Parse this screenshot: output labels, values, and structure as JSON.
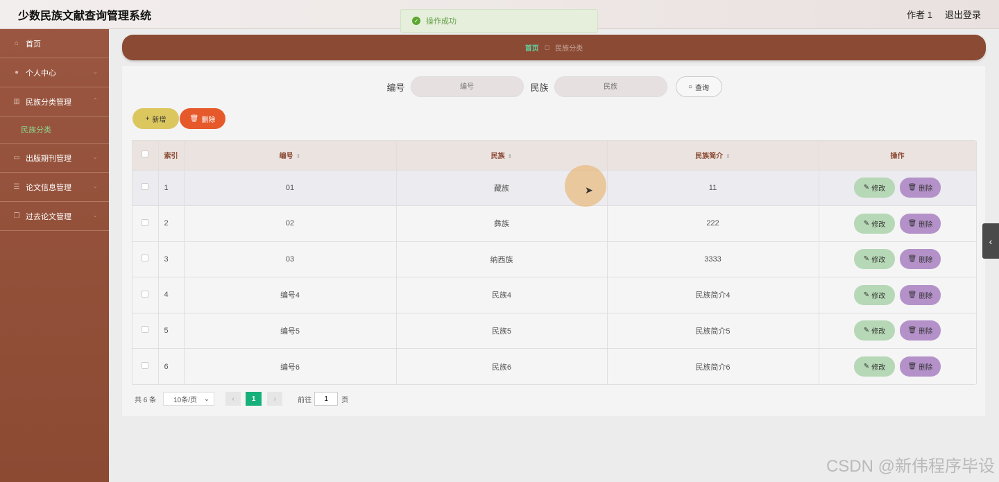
{
  "header": {
    "title": "少数民族文献查询管理系统",
    "user": "作者 1",
    "logout": "退出登录"
  },
  "toast": {
    "message": "操作成功"
  },
  "sidebar": {
    "items": [
      {
        "label": "首页"
      },
      {
        "label": "个人中心"
      },
      {
        "label": "民族分类管理",
        "sub": "民族分类"
      },
      {
        "label": "出版期刊管理"
      },
      {
        "label": "论文信息管理"
      },
      {
        "label": "过去论文管理"
      }
    ]
  },
  "breadcrumb": {
    "home": "首页",
    "current": "民族分类"
  },
  "search": {
    "code_label": "编号",
    "code_placeholder": "编号",
    "ethnic_label": "民族",
    "ethnic_placeholder": "民族",
    "query_label": "查询"
  },
  "actions": {
    "add_label": "新增",
    "delete_label": "删除"
  },
  "table": {
    "headers": {
      "index": "索引",
      "code": "编号",
      "ethnic": "民族",
      "intro": "民族简介",
      "ops": "操作"
    },
    "rows": [
      {
        "index": "1",
        "code": "01",
        "ethnic": "藏族",
        "intro": "11"
      },
      {
        "index": "2",
        "code": "02",
        "ethnic": "彝族",
        "intro": "222"
      },
      {
        "index": "3",
        "code": "03",
        "ethnic": "纳西族",
        "intro": "3333"
      },
      {
        "index": "4",
        "code": "编号4",
        "ethnic": "民族4",
        "intro": "民族简介4"
      },
      {
        "index": "5",
        "code": "编号5",
        "ethnic": "民族5",
        "intro": "民族简介5"
      },
      {
        "index": "6",
        "code": "编号6",
        "ethnic": "民族6",
        "intro": "民族简介6"
      }
    ],
    "edit_label": "修改",
    "delete_label": "删除"
  },
  "pagination": {
    "total": "共 6 条",
    "page_size": "10条/页",
    "current_page": "1",
    "goto_prefix": "前往",
    "goto_value": "1",
    "goto_suffix": "页"
  },
  "watermark": "CSDN @新伟程序毕设"
}
